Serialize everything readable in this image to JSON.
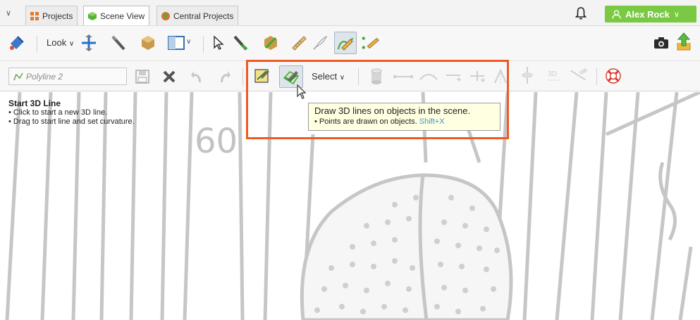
{
  "tabs": {
    "menu_icon": "chevron-down-icon",
    "items": [
      {
        "label": "Projects",
        "icon": "grid-icon",
        "color": "#e27b2a"
      },
      {
        "label": "Scene View",
        "icon": "cube-icon",
        "color": "#59b33a",
        "active": true
      },
      {
        "label": "Central Projects",
        "icon": "globe-icon",
        "color": "#d9722f"
      }
    ]
  },
  "header": {
    "notification_icon": "bell-icon",
    "user_name": "Alex Rock",
    "user_button_color": "#7ac943"
  },
  "toolbar1": {
    "look_label": "Look"
  },
  "toolbar2": {
    "polyline_name_placeholder": "Polyline 2",
    "select_label": "Select"
  },
  "instructions": {
    "title": "Start 3D Line",
    "lines": [
      "• Click to start a new 3D line.",
      "• Drag to start line and set curvature."
    ]
  },
  "tooltip": {
    "title": "Draw 3D lines on objects in the scene.",
    "subtitle": "• Points are drawn on objects.",
    "shortcut": "Shift+X"
  },
  "scene_labels": {
    "contour_label": "60"
  },
  "colors": {
    "highlight": "#f05a22",
    "tooltip_bg": "#ffffe1",
    "accent_green": "#7ac943"
  }
}
